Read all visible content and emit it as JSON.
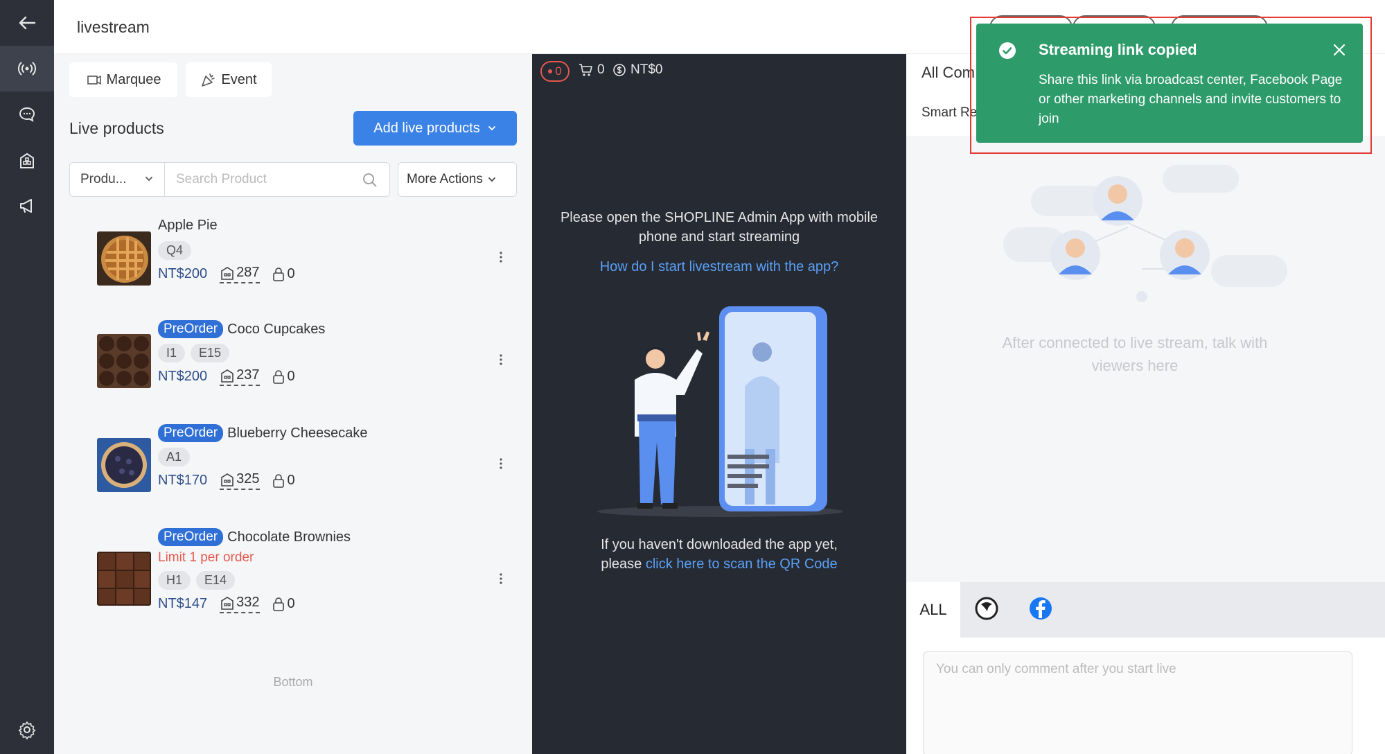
{
  "header": {
    "title": "livestream"
  },
  "left": {
    "chips": {
      "marquee": "Marquee",
      "event": "Event"
    },
    "section_title": "Live products",
    "add_button": "Add live products",
    "filter_select": "Produ...",
    "search_placeholder": "Search Product",
    "more_actions": "More Actions",
    "bottom": "Bottom",
    "products": [
      {
        "name": "Apple Pie",
        "badge": "",
        "limit": "",
        "tags": [
          "Q4"
        ],
        "price": "NT$200",
        "stock": "287",
        "locked": "0"
      },
      {
        "name": "Coco Cupcakes",
        "badge": "PreOrder",
        "limit": "",
        "tags": [
          "I1",
          "E15"
        ],
        "price": "NT$200",
        "stock": "237",
        "locked": "0"
      },
      {
        "name": "Blueberry Cheesecake",
        "badge": "PreOrder",
        "limit": "",
        "tags": [
          "A1"
        ],
        "price": "NT$170",
        "stock": "325",
        "locked": "0"
      },
      {
        "name": "Chocolate Brownies",
        "badge": "PreOrder",
        "limit": "Limit 1 per order",
        "tags": [
          "H1",
          "E14"
        ],
        "price": "NT$147",
        "stock": "332",
        "locked": "0"
      }
    ]
  },
  "middle": {
    "live_count": "0",
    "cart_count": "0",
    "sales": "NT$0",
    "message": "Please open the SHOPLINE Admin App with mobile phone and start streaming",
    "help_link": "How do I start livestream with the app?",
    "footer_text": "If you haven't downloaded the app yet,",
    "footer_prefix": "please",
    "footer_link": "click here to scan the QR Code"
  },
  "right": {
    "label_all": "All Com",
    "label_smart": "Smart Re",
    "empty_text": "After connected to live stream, talk with viewers here",
    "tab_all": "ALL",
    "comment_placeholder": "You can only comment after you start live"
  },
  "toast": {
    "title": "Streaming link copied",
    "body": "Share this link via broadcast center, Facebook Page or other marketing channels and invite customers to join"
  },
  "colors": {
    "rail": "#2d3039",
    "primary": "#3b82e6",
    "toast": "#2e9b6b",
    "price": "#2f4e89",
    "danger": "#e5584d",
    "link": "#5aa0f5"
  }
}
